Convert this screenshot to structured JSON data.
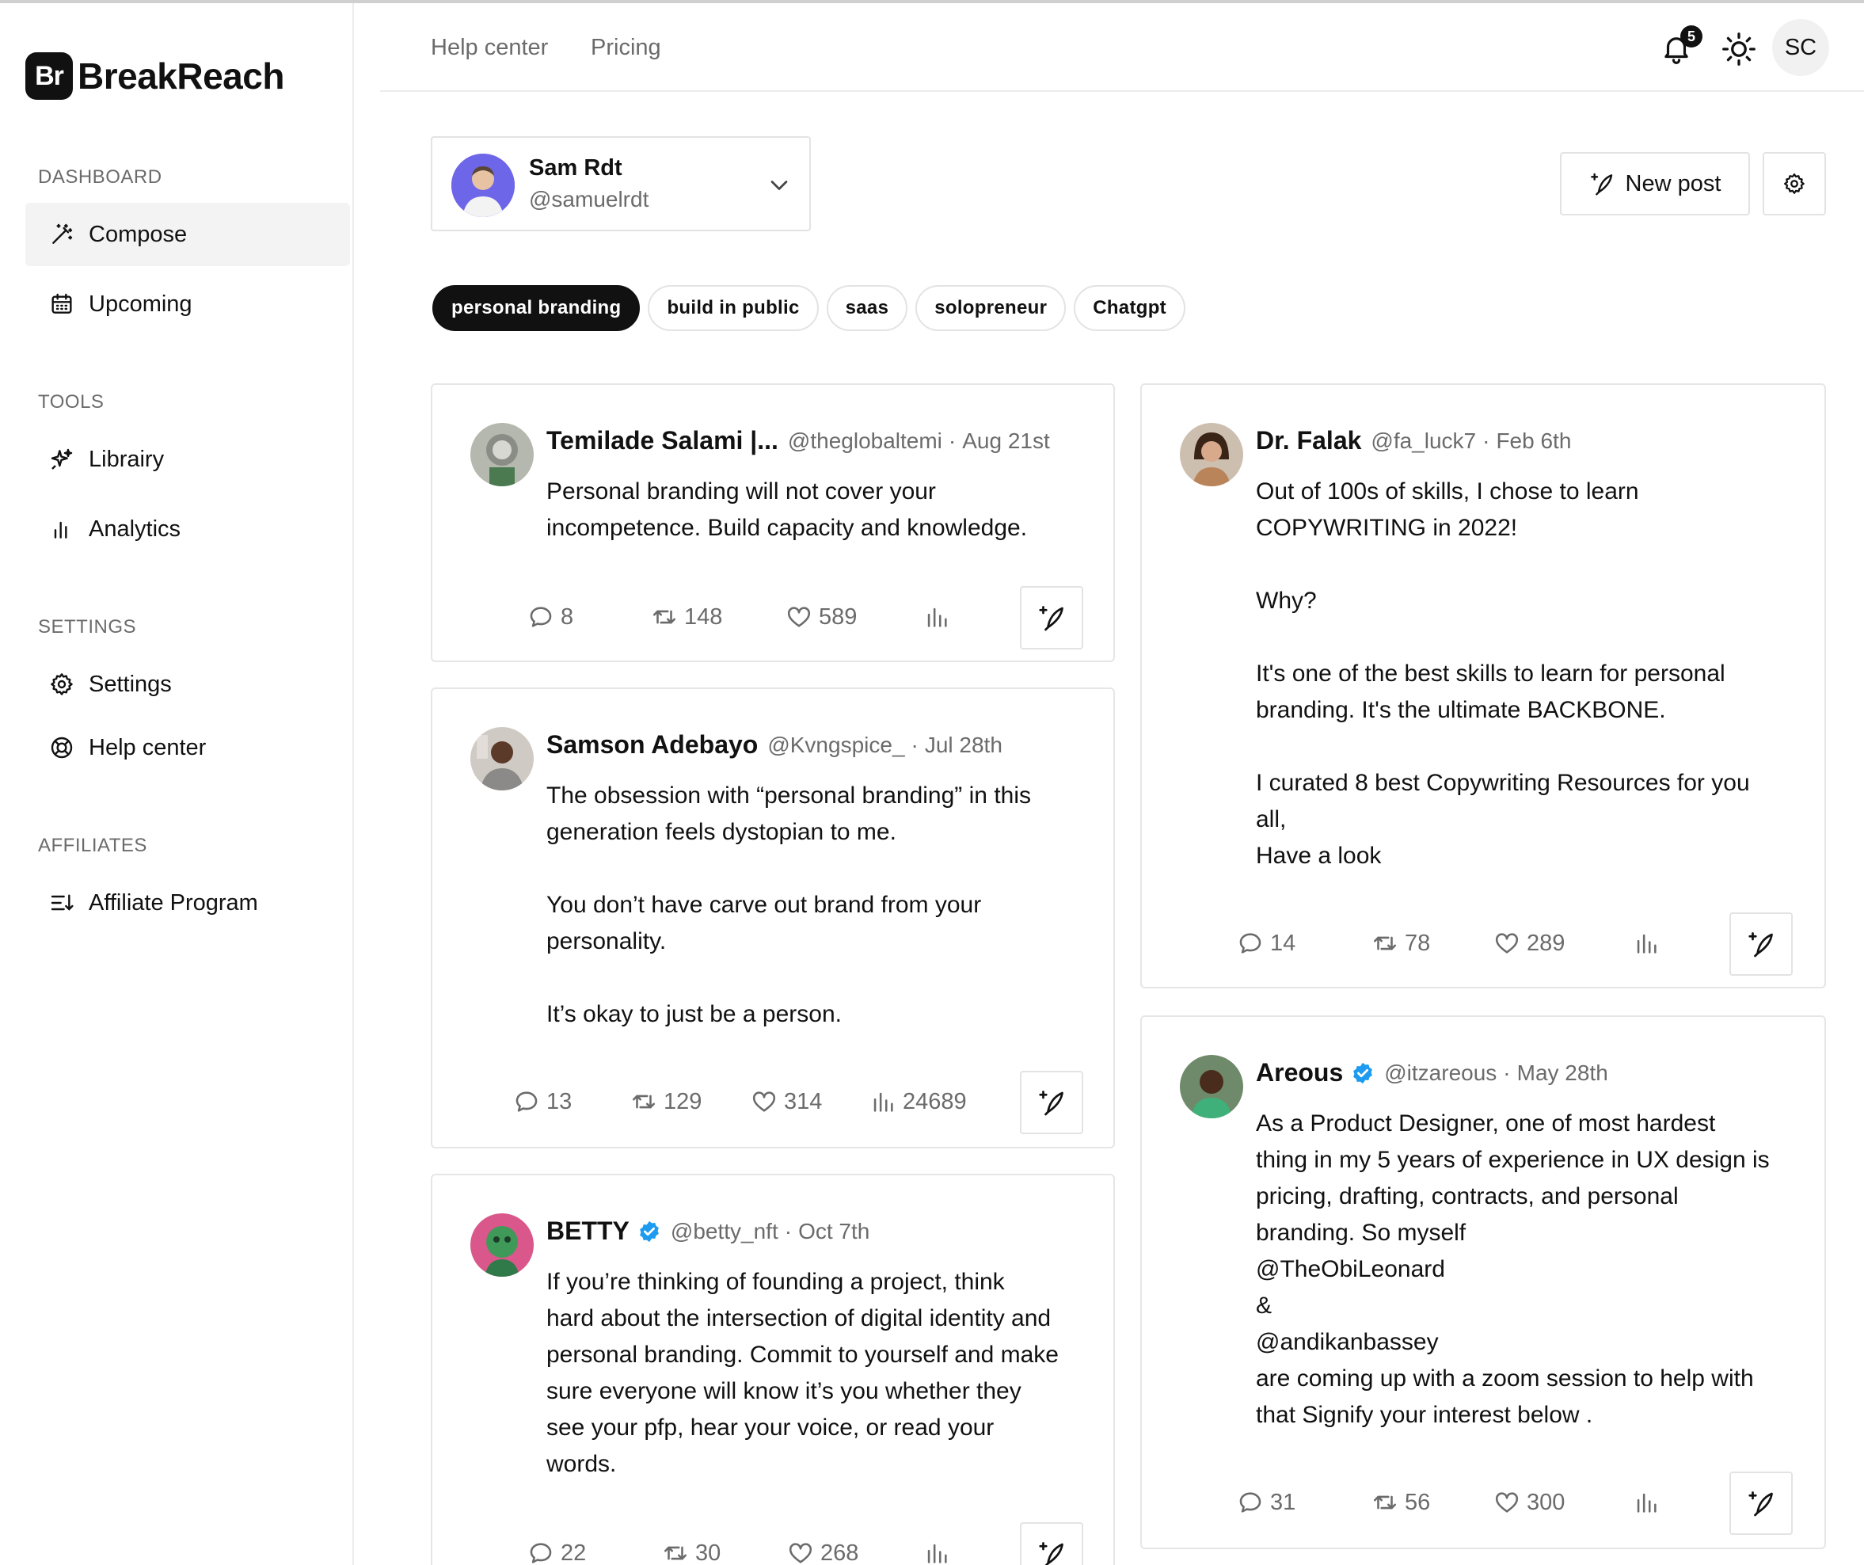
{
  "brand": {
    "logo_mark": "Br",
    "name": "BreakReach"
  },
  "sidebar": {
    "sections": [
      {
        "label": "DASHBOARD",
        "items": [
          {
            "label": "Compose",
            "icon": "magic-wand-icon",
            "active": true
          },
          {
            "label": "Upcoming",
            "icon": "calendar-icon"
          }
        ]
      },
      {
        "label": "TOOLS",
        "items": [
          {
            "label": "Librairy",
            "icon": "sparkles-icon"
          },
          {
            "label": "Analytics",
            "icon": "bar-chart-icon"
          }
        ]
      },
      {
        "label": "SETTINGS",
        "items": [
          {
            "label": "Settings",
            "icon": "gear-icon"
          },
          {
            "label": "Help center",
            "icon": "lifebuoy-icon"
          }
        ]
      },
      {
        "label": "AFFILIATES",
        "items": [
          {
            "label": "Affiliate Program",
            "icon": "list-icon"
          }
        ]
      }
    ]
  },
  "topbar": {
    "links": [
      "Help center",
      "Pricing"
    ],
    "notifications_count": "5",
    "user_initials": "SC"
  },
  "account": {
    "name": "Sam Rdt",
    "handle": "@samuelrdt"
  },
  "actions": {
    "new_post": "New post"
  },
  "tags": [
    {
      "label": "personal branding",
      "active": true
    },
    {
      "label": "build in public"
    },
    {
      "label": "saas"
    },
    {
      "label": "solopreneur"
    },
    {
      "label": "Chatgpt"
    }
  ],
  "posts": [
    {
      "name": "Temilade Salami |...",
      "verified": false,
      "handle": "@theglobaltemi",
      "date": "Aug 21st",
      "text": "Personal branding will not cover your\nincompetence. Build capacity and knowledge.",
      "replies": "8",
      "reposts": "148",
      "likes": "589",
      "views": ""
    },
    {
      "name": "Samson Adebayo",
      "verified": false,
      "handle": "@Kvngspice_",
      "date": "Jul 28th",
      "text": "The obsession with “personal branding” in this\ngeneration feels dystopian to me.\n\nYou don’t have carve out brand from your\npersonality.\n\nIt’s okay to just be a person.",
      "replies": "13",
      "reposts": "129",
      "likes": "314",
      "views": "24689"
    },
    {
      "name": "BETTY",
      "verified": true,
      "handle": "@betty_nft",
      "date": "Oct 7th",
      "text": "If you’re thinking of founding a project, think\nhard about the intersection of digital identity and\npersonal branding. Commit to yourself and make\nsure everyone will know it’s you whether they\nsee your pfp, hear your voice, or read your\nwords.",
      "replies": "22",
      "reposts": "30",
      "likes": "268",
      "views": ""
    },
    {
      "name": "Dr. Falak",
      "verified": false,
      "handle": "@fa_luck7",
      "date": "Feb 6th",
      "text": "Out of 100s of skills, I chose to learn\nCOPYWRITING in 2022!\n\nWhy?\n\nIt's one of the best skills to learn for personal\nbranding. It's the ultimate BACKBONE.\n\nI curated 8 best Copywriting Resources for you\nall,\nHave a look",
      "replies": "14",
      "reposts": "78",
      "likes": "289",
      "views": ""
    },
    {
      "name": "Areous",
      "verified": true,
      "handle": "@itzareous",
      "date": "May 28th",
      "text": "As a Product Designer, one of most hardest\nthing in my 5 years of experience in UX design is\npricing, drafting, contracts, and personal\nbranding. So myself\n@TheObiLeonard\n&\n@andikanbassey\nare coming up with a zoom session to help with\nthat Signify your interest below .",
      "replies": "31",
      "reposts": "56",
      "likes": "300",
      "views": ""
    }
  ],
  "colors": {
    "accent": "#111111",
    "verified": "#1d9bf0",
    "muted": "#6b6b6b",
    "border": "#e3e3e3"
  }
}
